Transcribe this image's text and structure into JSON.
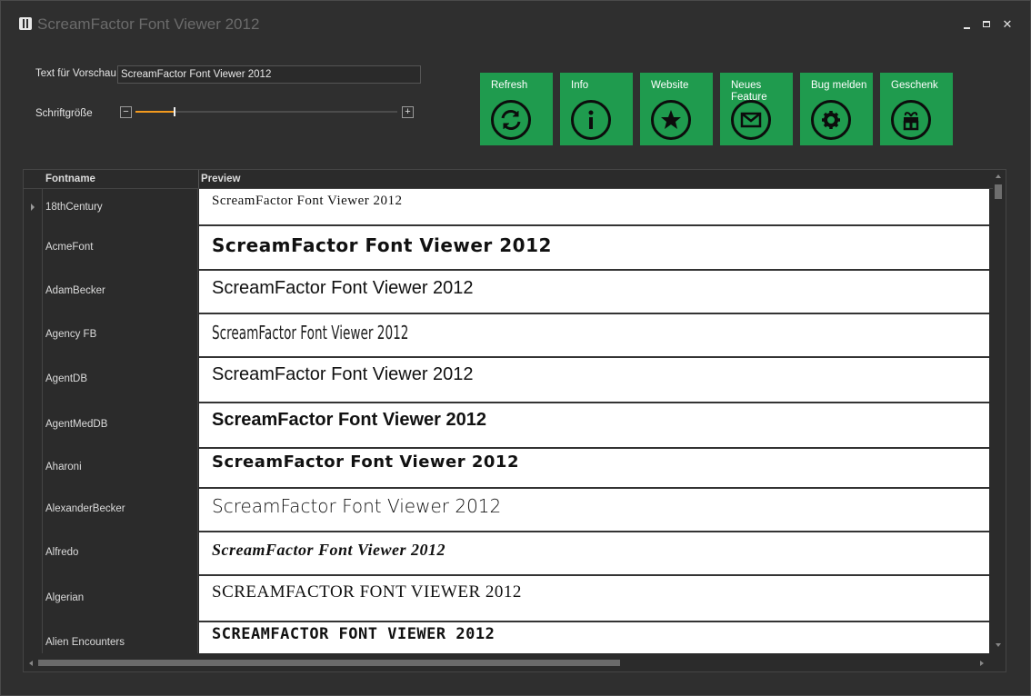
{
  "window": {
    "title": "ScreamFactor Font Viewer 2012",
    "controls": {
      "minimize": "",
      "maximize": "",
      "close": "✕"
    }
  },
  "settings": {
    "preview_text_label": "Text für Vorschau",
    "preview_text_value": "ScreamFactor Font Viewer 2012",
    "font_size_label": "Schriftgröße",
    "font_size_minus": "−",
    "font_size_plus": "+",
    "font_size_fraction": 0.15
  },
  "toolbar": [
    {
      "label": "Refresh",
      "icon": "refresh-icon"
    },
    {
      "label": "Info",
      "icon": "info-icon"
    },
    {
      "label": "Website",
      "icon": "star-icon"
    },
    {
      "label": "Neues Feature",
      "icon": "mail-icon"
    },
    {
      "label": "Bug melden",
      "icon": "gear-icon"
    },
    {
      "label": "Geschenk",
      "icon": "gift-icon"
    }
  ],
  "grid": {
    "columns": {
      "name": "Fontname",
      "preview": "Preview"
    },
    "rows": [
      {
        "name": "18thCentury",
        "preview": "ScreamFactor Font Viewer 2012",
        "selected": true
      },
      {
        "name": "AcmeFont",
        "preview": "ScreamFactor Font Viewer 2012"
      },
      {
        "name": "AdamBecker",
        "preview": "ScreamFactor Font Viewer 2012"
      },
      {
        "name": "Agency FB",
        "preview": "ScreamFactor Font Viewer 2012"
      },
      {
        "name": "AgentDB",
        "preview": "ScreamFactor Font Viewer 2012"
      },
      {
        "name": "AgentMedDB",
        "preview": "ScreamFactor Font Viewer 2012"
      },
      {
        "name": "Aharoni",
        "preview": "ScreamFactor Font Viewer 2012"
      },
      {
        "name": "AlexanderBecker",
        "preview": "ScreamFactor Font Viewer 2012"
      },
      {
        "name": "Alfredo",
        "preview": "ScreamFactor Font Viewer 2012"
      },
      {
        "name": "Algerian",
        "preview": "SCREAMFACTOR FONT VIEWER 2012"
      },
      {
        "name": "Alien Encounters",
        "preview": "SCREAMFACTOR FONT VIEWER 2012"
      }
    ]
  },
  "colors": {
    "tile_green": "#1f9b4e",
    "slider_accent": "#f39a1e",
    "background": "#2f2f2f"
  }
}
